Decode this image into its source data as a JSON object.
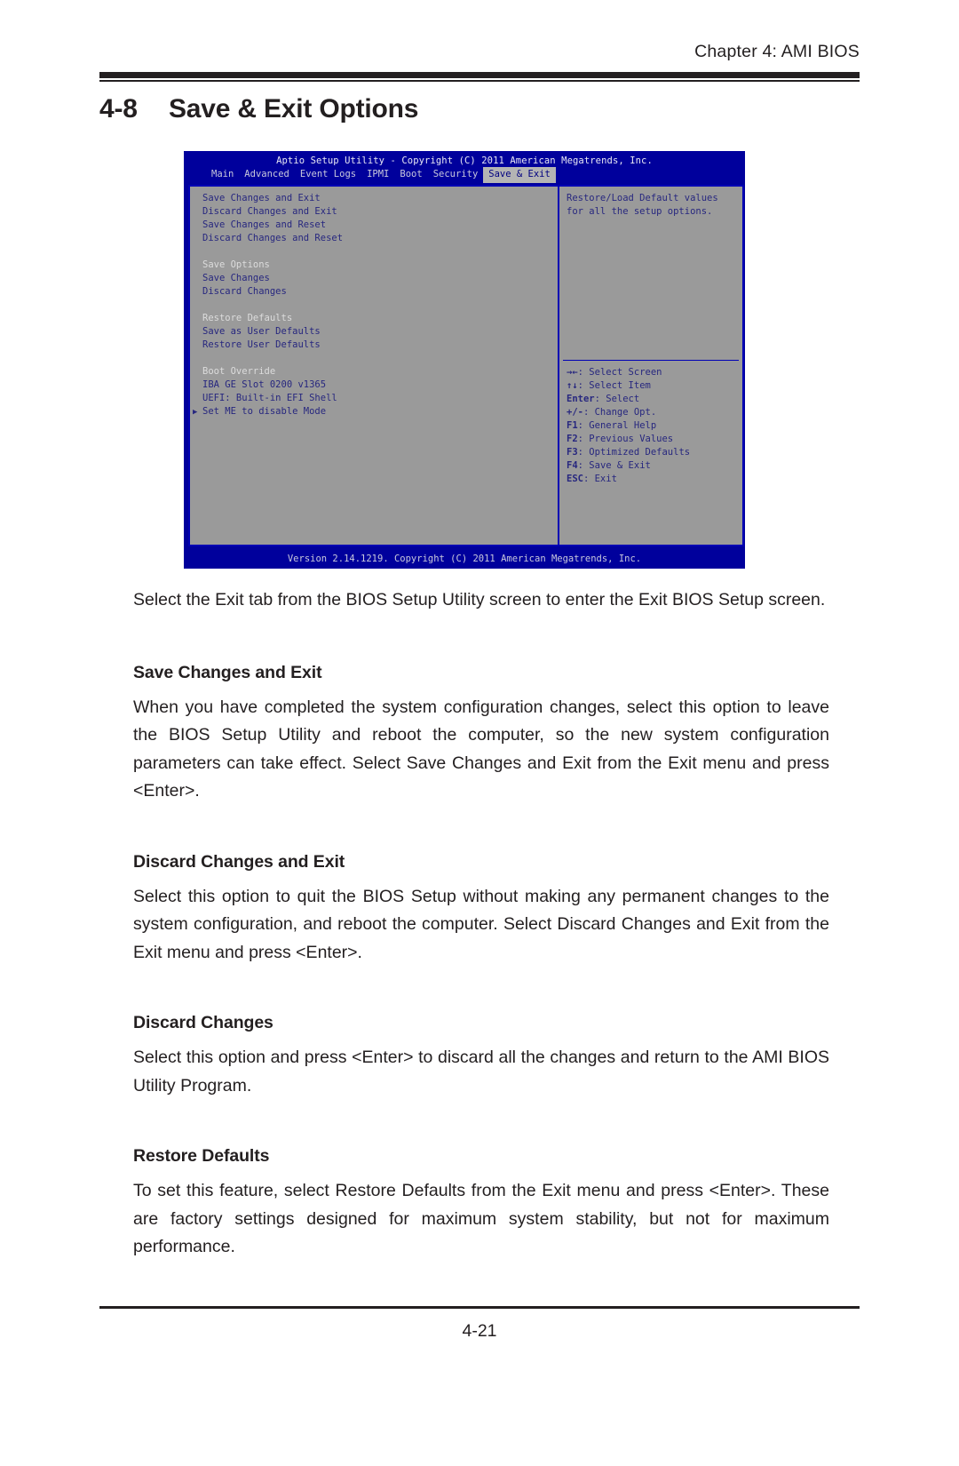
{
  "header": {
    "chapter_label": "Chapter 4: AMI BIOS"
  },
  "section": {
    "number": "4-8",
    "title": "Save & Exit Options"
  },
  "bios": {
    "title_bar": "Aptio Setup Utility - Copyright (C) 2011 American Megatrends, Inc.",
    "menu_tabs": [
      {
        "label": "Main",
        "active": false
      },
      {
        "label": "Advanced",
        "active": false
      },
      {
        "label": "Event Logs",
        "active": false
      },
      {
        "label": "IPMI",
        "active": false
      },
      {
        "label": "Boot",
        "active": false
      },
      {
        "label": "Security",
        "active": false
      },
      {
        "label": "Save & Exit",
        "active": true
      }
    ],
    "left_items": [
      {
        "label": "Save Changes and Exit",
        "type": "option",
        "bullet": false
      },
      {
        "label": "Discard Changes and Exit",
        "type": "option",
        "bullet": false
      },
      {
        "label": "Save Changes and Reset",
        "type": "option",
        "bullet": false
      },
      {
        "label": "Discard Changes and Reset",
        "type": "option",
        "bullet": false
      },
      {
        "label": "",
        "type": "spacer",
        "bullet": false
      },
      {
        "label": "Save Options",
        "type": "heading",
        "bullet": false
      },
      {
        "label": "Save Changes",
        "type": "option",
        "bullet": false
      },
      {
        "label": "Discard Changes",
        "type": "option",
        "bullet": false
      },
      {
        "label": "",
        "type": "spacer",
        "bullet": false
      },
      {
        "label": "Restore Defaults",
        "type": "heading",
        "bullet": false
      },
      {
        "label": "Save as User Defaults",
        "type": "option",
        "bullet": false
      },
      {
        "label": "Restore User Defaults",
        "type": "option",
        "bullet": false
      },
      {
        "label": "",
        "type": "spacer",
        "bullet": false
      },
      {
        "label": "Boot Override",
        "type": "heading",
        "bullet": false
      },
      {
        "label": "IBA GE Slot 0200 v1365",
        "type": "option",
        "bullet": false
      },
      {
        "label": "UEFI: Built-in EFI Shell",
        "type": "option",
        "bullet": false
      },
      {
        "label": "Set ME to disable Mode",
        "type": "option",
        "bullet": true
      }
    ],
    "help_lines": [
      "Restore/Load Default values",
      "for all the setup options."
    ],
    "nav_keys": [
      {
        "key": "→←",
        "desc": ": Select Screen"
      },
      {
        "key": "↑↓",
        "desc": ": Select Item"
      },
      {
        "key": "Enter",
        "desc": ": Select"
      },
      {
        "key": "+/-",
        "desc": ": Change Opt."
      },
      {
        "key": "F1",
        "desc": ": General Help"
      },
      {
        "key": "F2",
        "desc": ": Previous Values"
      },
      {
        "key": "F3",
        "desc": ": Optimized Defaults"
      },
      {
        "key": "F4",
        "desc": ": Save & Exit"
      },
      {
        "key": "ESC",
        "desc": ": Exit"
      }
    ],
    "footer_bar": "Version 2.14.1219. Copyright (C) 2011 American Megatrends, Inc.",
    "colors": {
      "chrome_blue": "#00009C",
      "panel_gray": "#9A9A9A",
      "item_blue": "#27277F",
      "heading_gray": "#DCDCDC",
      "active_tab_bg": "#B4B4B4"
    }
  },
  "content": {
    "intro": "Select the Exit tab from the BIOS Setup Utility screen to enter the Exit BIOS Setup screen.",
    "sections": [
      {
        "heading": "Save Changes and Exit",
        "body": "When you have completed the system configuration changes, select this option to leave the BIOS Setup Utility and reboot the computer, so the new system configuration parameters can take effect. Select Save Changes and Exit from the Exit menu and press <Enter>."
      },
      {
        "heading": "Discard Changes and Exit",
        "body": "Select this option to quit the BIOS Setup without making any permanent changes to the system configuration, and reboot the computer. Select Discard Changes and Exit from the Exit menu and press <Enter>."
      },
      {
        "heading": "Discard Changes",
        "body": "Select this option and press <Enter> to discard all the changes and return to the AMI BIOS Utility Program."
      },
      {
        "heading": "Restore Defaults",
        "body": "To set this feature, select Restore Defaults from the Exit menu and press <Enter>. These are factory settings designed for maximum system stability, but not for maximum performance."
      }
    ]
  },
  "footer": {
    "page_number": "4-21"
  }
}
